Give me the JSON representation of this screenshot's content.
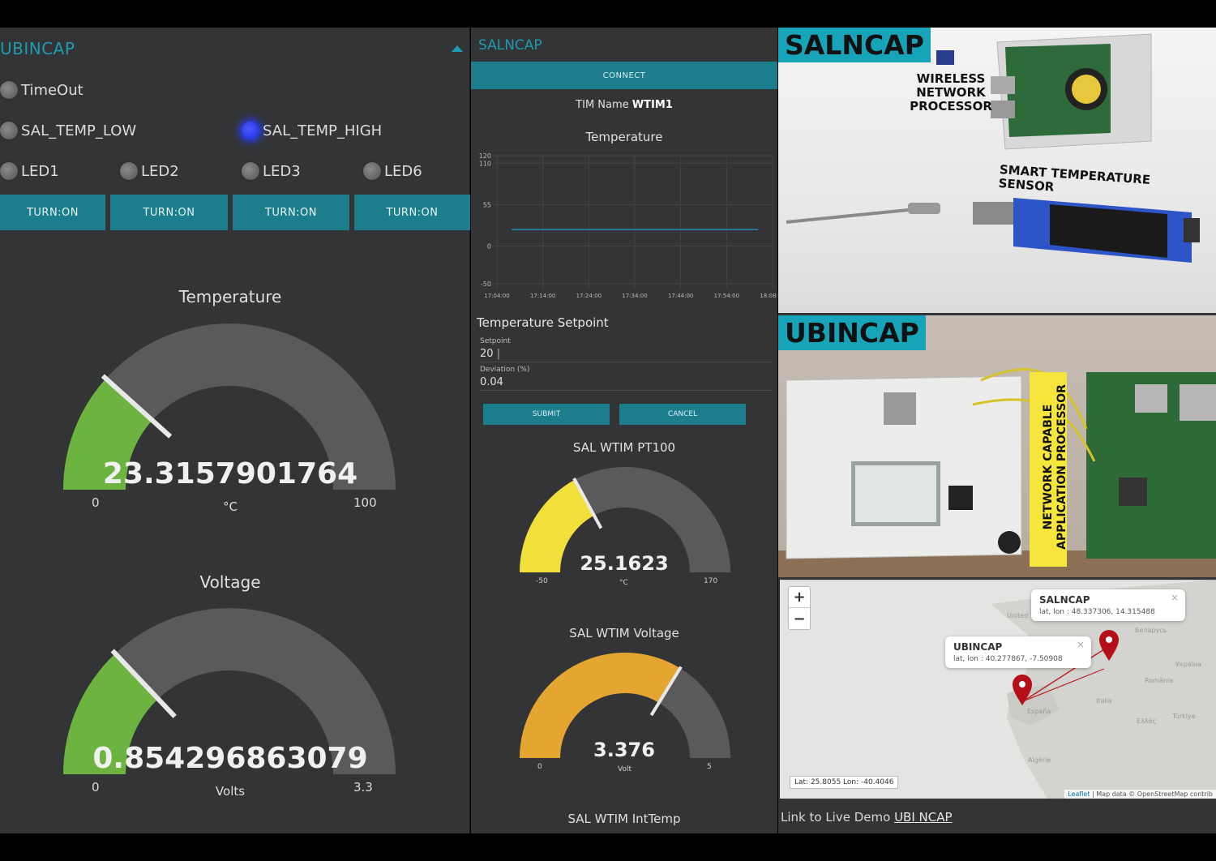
{
  "left_panel": {
    "title": "UBINCAP",
    "leds": [
      {
        "label": "TimeOut",
        "on": false
      },
      {
        "label": "SAL_TEMP_LOW",
        "on": false
      },
      {
        "label": "SAL_TEMP_HIGH",
        "on": true
      },
      {
        "label": "LED1",
        "on": false
      },
      {
        "label": "LED2",
        "on": false
      },
      {
        "label": "LED3",
        "on": false
      },
      {
        "label": "LED6",
        "on": false
      }
    ],
    "turn_buttons": [
      "TURN:ON",
      "TURN:ON",
      "TURN:ON",
      "TURN:ON"
    ],
    "temperature_gauge": {
      "title": "Temperature",
      "value": "23.3157901764",
      "value_num": 23.3157901764,
      "min": "0",
      "max": "100",
      "unit": "°C",
      "fill_color": "#6db33f"
    },
    "voltage_gauge": {
      "title": "Voltage",
      "value": "0.854296863079",
      "value_num": 0.854296863079,
      "min": "0",
      "max": "3.3",
      "unit": "Volts",
      "fill_color": "#6db33f"
    }
  },
  "middle_panel": {
    "title": "SALNCAP",
    "connect_label": "CONNECT",
    "tim_name_label": "TIM Name",
    "tim_name_value": "WTIM1",
    "chart_title": "Temperature",
    "setpoint_title": "Temperature Setpoint",
    "setpoint_label": "Setpoint",
    "setpoint_value": "20",
    "deviation_label": "Deviation (%)",
    "deviation_value": "0.04",
    "submit_label": "SUBMIT",
    "cancel_label": "CANCEL",
    "pt100_gauge": {
      "title": "SAL WTIM PT100",
      "value": "25.1623",
      "value_num": 25.1623,
      "min": "-50",
      "max": "170",
      "unit": "°C",
      "fill_color": "#f2e03a"
    },
    "voltage_gauge": {
      "title": "SAL WTIM Voltage",
      "value": "3.376",
      "value_num": 3.376,
      "min": "0",
      "max": "5",
      "unit": "Volt",
      "fill_color": "#e4a531"
    },
    "inttemp_title": "SAL WTIM IntTemp"
  },
  "chart_data": {
    "type": "line",
    "title": "Temperature",
    "x": [
      "17:04:00",
      "17:14:00",
      "17:24:00",
      "17:34:00",
      "17:44:00",
      "17:54:00",
      "18:08:00"
    ],
    "series": [
      {
        "values": [
          22,
          22,
          22,
          22,
          22,
          22
        ]
      }
    ],
    "y_ticks": [
      "120",
      "110",
      "55",
      "0",
      "-50"
    ],
    "ylim": [
      -50,
      120
    ],
    "grid": true,
    "line_color": "#2a88b8"
  },
  "right_panel": {
    "salncap_tag": "SALNCAP",
    "wireless_label": "WIRELESS NETWORK PROCESSOR",
    "sensor_label": "SMART TEMPERATURE SENSOR",
    "ubincap_tag": "UBINCAP",
    "ncap_label": "NETWORK CAPABLE APPLICATION PROCESSOR",
    "map": {
      "zoom_in": "+",
      "zoom_out": "−",
      "salncap_popup_title": "SALNCAP",
      "salncap_popup_coords": "lat, lon : 48.337306, 14.315488",
      "ubincap_popup_title": "UBINCAP",
      "ubincap_popup_coords": "lat, lon : 40.277867, -7.50908",
      "latlon_readout": "Lat: 25.8055 Lon: -40.4046",
      "attribution_leaflet": "Leaflet",
      "attribution_rest": " | Map data © OpenStreetMap contrib"
    },
    "demo_prefix": "Link to Live Demo",
    "demo_link": "UBI NCAP"
  }
}
